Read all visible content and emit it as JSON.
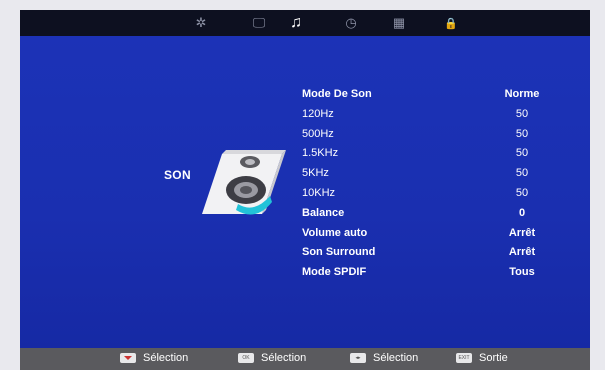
{
  "tabs": [
    {
      "icon": "gear-icon",
      "label": "✲"
    },
    {
      "icon": "monitor-icon",
      "label": "🖵"
    },
    {
      "icon": "music-note-icon",
      "label": "♫"
    },
    {
      "icon": "clock-icon",
      "label": "◷"
    },
    {
      "icon": "grid-icon",
      "label": "▦"
    },
    {
      "icon": "lock-icon",
      "label": "🔒"
    }
  ],
  "active_tab": "music-note-icon",
  "section": {
    "title": "SON"
  },
  "menu": [
    {
      "label": "Mode De Son",
      "value": "Norme"
    },
    {
      "label": "120Hz",
      "value": "50"
    },
    {
      "label": "500Hz",
      "value": "50"
    },
    {
      "label": "1.5KHz",
      "value": "50"
    },
    {
      "label": "5KHz",
      "value": "50"
    },
    {
      "label": "10KHz",
      "value": "50"
    },
    {
      "label": "Balance",
      "value": "0"
    },
    {
      "label": "Volume auto",
      "value": "Arrêt"
    },
    {
      "label": "Son Surround",
      "value": "Arrêt"
    },
    {
      "label": "Mode SPDIF",
      "value": "Tous"
    }
  ],
  "footer": [
    {
      "key": "select-key-icon",
      "key_text": "",
      "label": "Sélection"
    },
    {
      "key": "ok-key-icon",
      "key_text": "OK",
      "label": "Sélection"
    },
    {
      "key": "arrows-key-icon",
      "key_text": "◂▸",
      "label": "Sélection"
    },
    {
      "key": "exit-key-icon",
      "key_text": "EXIT",
      "label": "Sortie"
    }
  ],
  "colors": {
    "background": "#1a2fb0",
    "topbar": "#0d1020",
    "footer": "#5a5a5e",
    "speaker_accent": "#22c3d8"
  }
}
